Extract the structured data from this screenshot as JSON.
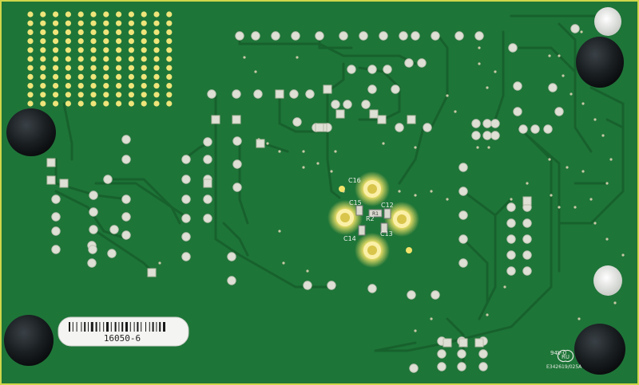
{
  "board": {
    "serial_label": "16050-6",
    "mark_ul": "94V-0",
    "mark_code": "E342619/025A",
    "mark_ru": "RU",
    "colors": {
      "solder_mask": "#1d7336",
      "trace": "#17632d",
      "pad": "#dcdcd0",
      "bga_pad": "#efe57a",
      "foot": "#15191c",
      "glow": "#f6df62"
    }
  },
  "components": {
    "c16": "C16",
    "c15": "C15",
    "c12": "C12",
    "r2": "R2",
    "c13": "C13",
    "c14": "C14",
    "r1": "R1"
  }
}
